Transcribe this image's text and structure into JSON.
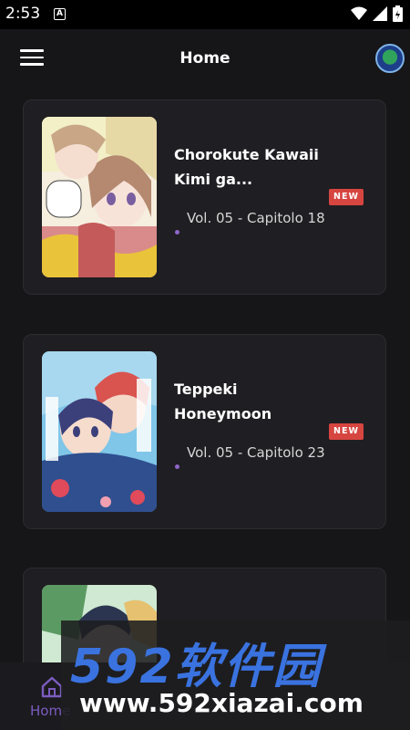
{
  "status_bar": {
    "time": "2:53",
    "notification_letter": "A"
  },
  "header": {
    "title": "Home"
  },
  "manga_list": [
    {
      "title": "Chorokute Kawaii Kimi ga...",
      "badge": "NEW",
      "chapter": "Vol. 05 - Capitolo 18"
    },
    {
      "title": "Teppeki Honeymoon",
      "badge": "NEW",
      "chapter": "Vol. 05 - Capitolo 23"
    }
  ],
  "bottom_nav": {
    "home_label": "Home"
  },
  "watermark": {
    "brand": "592软件园",
    "url": "www.592xiazai.com"
  },
  "colors": {
    "background": "#161518",
    "card": "#1f1e22",
    "badge": "#d64540",
    "accent": "#7b5cc0",
    "watermark_blue": "#3a73e0"
  }
}
